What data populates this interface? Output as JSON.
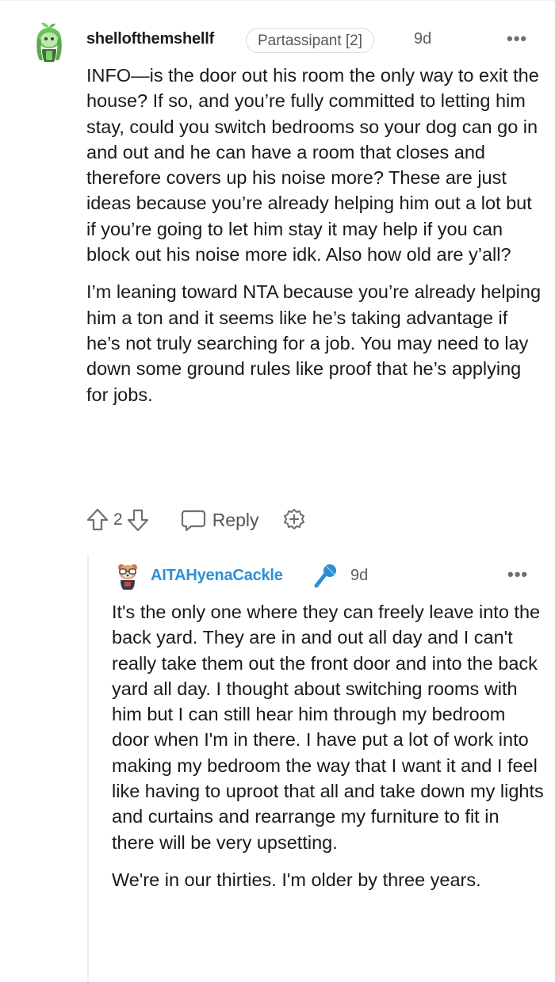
{
  "comment": {
    "username": "shellofthemshellf",
    "flair": "Partassipant [2]",
    "time": "9d",
    "more": "•••",
    "paragraphs": [
      "INFO—is the door out his room the only way to exit the house? If so, and you’re fully committed to letting him stay, could you switch bedrooms so your dog can go in and out and he can have a room that closes and therefore covers up his noise more? These are just ideas because you’re already helping him out a lot but if you’re going to let him stay it may help if you can block out his noise more idk. Also how old are y’all?",
      "I’m leaning toward NTA because you’re already helping him a ton and it seems like he’s taking advantage if he’s not truly searching for a job. You may need to lay down some ground rules like proof that he’s applying for jobs."
    ],
    "actions": {
      "vote_count": "2",
      "reply_label": "Reply"
    }
  },
  "reply": {
    "username": "AITAHyenaCackle",
    "time": "9d",
    "more": "•••",
    "paragraphs": [
      "It's the only one where they can freely leave into the back yard. They are in and out all day and I can't really take them out the front door and into the back yard all day. I thought about switching rooms with him but I can still hear him through my bedroom door when I'm in there. I have put a lot of work into making my bedroom the way that I want it and I feel like having to uproot that all and take down my lights and curtains and rearrange my furniture to fit in there will be very upsetting.",
      "We're in our thirties. I'm older by three years."
    ]
  },
  "colors": {
    "text": "#1a1a1b",
    "meta": "#5c6063",
    "op_blue": "#2c8fd6",
    "divider": "#edeff1"
  },
  "icons": [
    "avatar-snoo-green",
    "upvote-icon",
    "downvote-icon",
    "reply-icon",
    "award-icon",
    "avatar-snoo-hyena",
    "microphone-icon",
    "more-options-icon"
  ]
}
